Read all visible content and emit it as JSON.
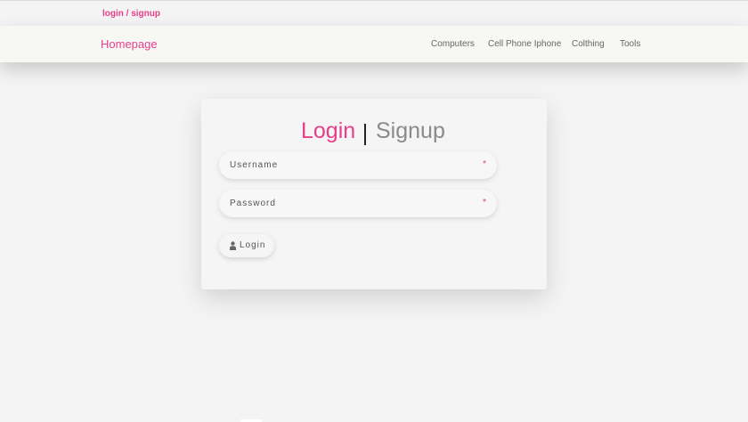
{
  "topbar": {
    "auth_link": "login / signup"
  },
  "navbar": {
    "brand": "Homepage",
    "links": [
      "Computers",
      "Cell Phone Iphone",
      "Colthing",
      "Tools"
    ]
  },
  "auth_card": {
    "tab_login": "Login",
    "tab_signup": "Signup",
    "username_placeholder": "Username",
    "password_placeholder": "Password",
    "required_marker": "*",
    "login_button": "Login",
    "login_button_icon": "user-icon"
  },
  "colors": {
    "accent": "#e83e8c",
    "required": "#e0404a",
    "background": "#f4f4f4"
  }
}
